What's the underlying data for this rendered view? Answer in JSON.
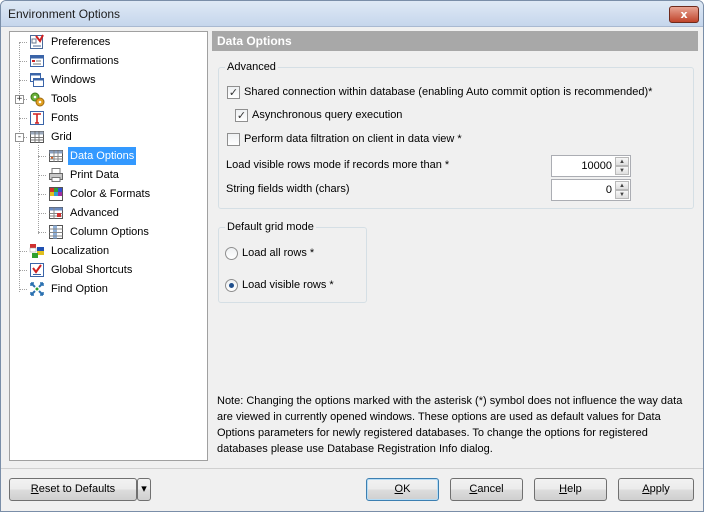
{
  "window": {
    "title": "Environment Options",
    "close_glyph": "x"
  },
  "tree": {
    "items": [
      {
        "label": "Preferences",
        "icon": "preferences-icon"
      },
      {
        "label": "Confirmations",
        "icon": "confirmations-icon"
      },
      {
        "label": "Windows",
        "icon": "windows-icon"
      },
      {
        "label": "Tools",
        "icon": "tools-icon",
        "expander": "+"
      },
      {
        "label": "Fonts",
        "icon": "fonts-icon"
      },
      {
        "label": "Grid",
        "icon": "grid-icon",
        "expander": "-"
      },
      {
        "label": "Data Options",
        "icon": "data-options-icon",
        "selected": true
      },
      {
        "label": "Print Data",
        "icon": "print-data-icon"
      },
      {
        "label": "Color & Formats",
        "icon": "color-formats-icon"
      },
      {
        "label": "Advanced",
        "icon": "advanced-icon"
      },
      {
        "label": "Column Options",
        "icon": "column-options-icon"
      },
      {
        "label": "Localization",
        "icon": "localization-icon"
      },
      {
        "label": "Global Shortcuts",
        "icon": "global-shortcuts-icon"
      },
      {
        "label": "Find Option",
        "icon": "find-option-icon"
      }
    ]
  },
  "panel": {
    "header": "Data Options",
    "advanced": {
      "title": "Advanced",
      "shared_connection": {
        "label": "Shared connection within database (enabling Auto commit option is recommended)*",
        "checked": true
      },
      "async_query": {
        "label": "Asynchronous query execution",
        "checked": true
      },
      "client_filtration": {
        "label": "Perform data filtration on client in data view *",
        "checked": false
      },
      "visible_rows": {
        "label": "Load visible rows mode if records more than *",
        "value": "10000"
      },
      "string_width": {
        "label": "String fields width (chars)",
        "value": "0"
      }
    },
    "grid_mode": {
      "title": "Default grid mode",
      "load_all": {
        "label": "Load all rows *",
        "selected": false
      },
      "load_visible": {
        "label": "Load visible rows *",
        "selected": true
      }
    },
    "note": "Note: Changing the options marked with the asterisk (*) symbol does not influence the way data are viewed in currently opened windows. These options are used as default values for Data Options parameters for newly registered databases. To change the options for registered databases please use Database Registration Info dialog."
  },
  "buttons": {
    "reset": {
      "pre": "",
      "accel": "R",
      "post": "eset to Defaults"
    },
    "reset_dropdown": "▾",
    "ok": {
      "pre": "",
      "accel": "O",
      "post": "K"
    },
    "cancel": {
      "pre": "",
      "accel": "C",
      "post": "ancel"
    },
    "help": {
      "pre": "",
      "accel": "H",
      "post": "elp"
    },
    "apply": {
      "pre": "",
      "accel": "A",
      "post": "pply"
    }
  },
  "colors": {
    "selection": "#3399ff",
    "header_bg": "#a8a8a8",
    "window_bg": "#f0f0f0"
  }
}
